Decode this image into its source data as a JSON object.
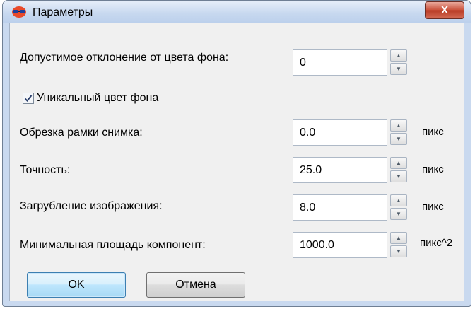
{
  "window": {
    "title": "Параметры",
    "close_glyph": "X"
  },
  "fields": [
    {
      "label": "Допустимое отклонение от цвета фона:",
      "value": "0",
      "unit": ""
    },
    {
      "label": "Обрезка рамки снимка:",
      "value": "0.0",
      "unit": "пикс"
    },
    {
      "label": "Точность:",
      "value": "25.0",
      "unit": "пикс"
    },
    {
      "label": "Загрубление изображения:",
      "value": "8.0",
      "unit": "пикс"
    },
    {
      "label": "Минимальная площадь компонент:",
      "value": "1000.0",
      "unit": "пикс^2"
    }
  ],
  "unique_bg_checkbox": {
    "label": "Уникальный цвет фона",
    "checked": true
  },
  "buttons": {
    "ok": "OK",
    "cancel": "Отмена"
  },
  "icons": {
    "app": "glasses-icon",
    "close": "close-icon",
    "spin_up": "triangle-up-icon",
    "spin_down": "triangle-down-icon",
    "check": "checkmark-icon"
  },
  "colors": {
    "titlebar": "#c7d8ef",
    "close_button": "#c9503a",
    "client_bg": "#f0f0f0",
    "ok_border": "#3c7fb1"
  }
}
